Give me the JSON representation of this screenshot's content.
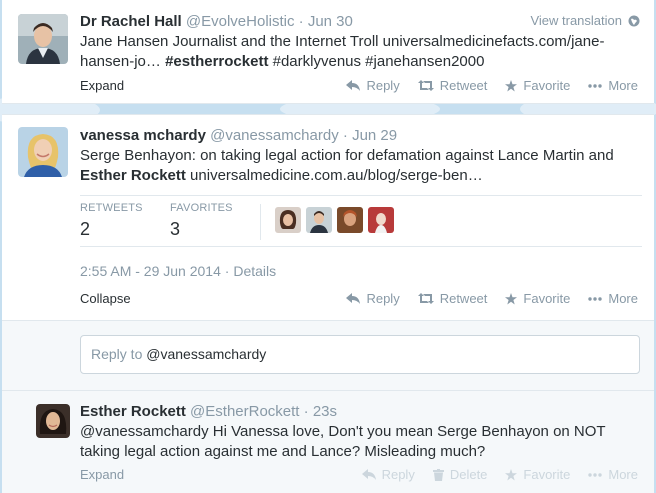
{
  "tweet1": {
    "fullname": "Dr Rachel Hall",
    "handle": "@EvolveHolistic",
    "time": "Jun 30",
    "view_translation": "View translation",
    "text_part1": "Jane Hansen Journalist and the Internet Troll universalmedicinefacts.com/jane-hansen-jo…",
    "hashtag_bold": "#estherrockett",
    "text_part2": "#darklyvenus #janehansen2000",
    "expand": "Expand",
    "actions": {
      "reply": "Reply",
      "retweet": "Retweet",
      "favorite": "Favorite",
      "more": "More"
    }
  },
  "tweet2": {
    "fullname": "vanessa mchardy",
    "handle": "@vanessamchardy",
    "time": "Jun 29",
    "text_part1": "Serge Benhayon: on taking legal action for defamation against Lance Martin and",
    "text_bold": "Esther Rockett",
    "text_part2": "universalmedicine.com.au/blog/serge-ben…",
    "stats": {
      "retweets_label": "RETWEETS",
      "retweets_value": "2",
      "favorites_label": "FAVORITES",
      "favorites_value": "3"
    },
    "timestamp": "2:55 AM - 29 Jun 2014",
    "details": "Details",
    "collapse": "Collapse",
    "actions": {
      "reply": "Reply",
      "retweet": "Retweet",
      "favorite": "Favorite",
      "more": "More"
    }
  },
  "reply_box": {
    "prefix": "Reply to",
    "mention": "@vanessamchardy"
  },
  "tweet3": {
    "fullname": "Esther Rockett",
    "handle": "@EstherRockett",
    "time": "23s",
    "text": "@vanessamchardy Hi Vanessa love, Don't you mean Serge Benhayon on NOT taking legal action against me and Lance? Misleading much?",
    "expand": "Expand",
    "actions": {
      "reply": "Reply",
      "delete": "Delete",
      "favorite": "Favorite",
      "more": "More"
    }
  },
  "colors": {
    "background": "#c6dff0",
    "text": "#292f33",
    "muted": "#8899a6",
    "border": "#e1e8ed"
  }
}
